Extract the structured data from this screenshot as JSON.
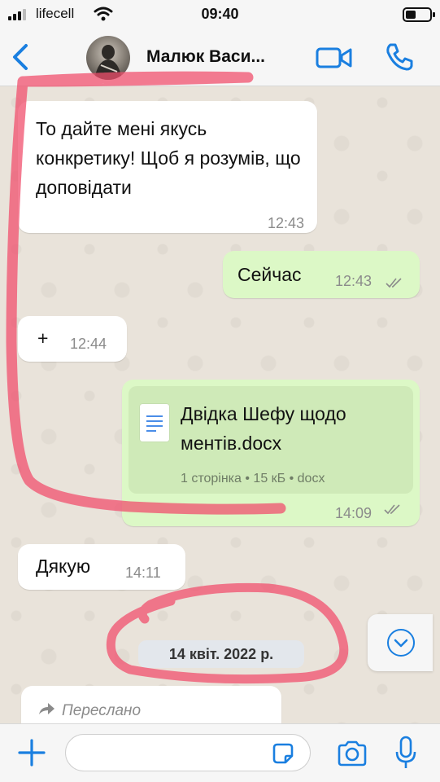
{
  "status_bar": {
    "carrier": "lifecell",
    "time": "09:40"
  },
  "header": {
    "contact_name": "Малюк Васи...",
    "icons": {
      "back": "chevron-left-icon",
      "video": "video-camera-icon",
      "call": "phone-icon"
    }
  },
  "messages": [
    {
      "direction": "incoming",
      "text": "То дайте мені якусь конкретику! Щоб я розумів, що доповідати",
      "time": "12:43"
    },
    {
      "direction": "outgoing",
      "text": "Сейчас",
      "time": "12:43",
      "read": true
    },
    {
      "direction": "incoming",
      "text": "+",
      "time": "12:44"
    },
    {
      "direction": "outgoing",
      "type": "document",
      "file_name": "Двідка Шефу щодо ментів.docx",
      "file_info": "1 сторінка • 15 кБ • docx",
      "time": "14:09",
      "read": true
    },
    {
      "direction": "incoming",
      "text": "Дякую",
      "time": "14:11"
    }
  ],
  "date_separator": "14 квіт. 2022 р.",
  "forwarded_preview": {
    "label": "Переслано"
  },
  "input_bar": {
    "placeholder": "",
    "icons": [
      "plus-icon",
      "sticker-icon",
      "camera-icon",
      "microphone-icon"
    ]
  },
  "colors": {
    "accent": "#1a7fe0",
    "outgoing_bubble": "#dcf8c6",
    "incoming_bubble": "#ffffff",
    "annotation": "#f0506e"
  }
}
